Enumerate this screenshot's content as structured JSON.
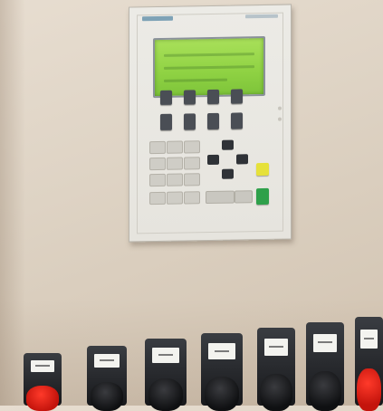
{
  "scene": {
    "panel_lcd_color": "#8fd243",
    "keypad_accent_colors": [
      "#e6e13a",
      "#2ea04a"
    ],
    "button_cap_colors": [
      "red",
      "black",
      "black",
      "black",
      "black",
      "black",
      "red"
    ]
  }
}
